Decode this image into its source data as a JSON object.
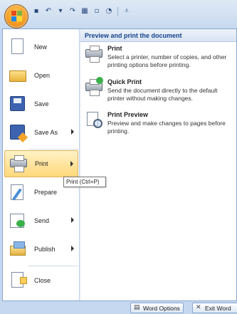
{
  "qat": {
    "icons": [
      "save-icon",
      "undo-icon",
      "redo-icon",
      "table-icon",
      "new-doc-icon",
      "print-preview-icon",
      "customize-icon"
    ]
  },
  "menu": {
    "items": [
      {
        "label": "New",
        "has_submenu": false
      },
      {
        "label": "Open",
        "has_submenu": false
      },
      {
        "label": "Save",
        "has_submenu": false
      },
      {
        "label": "Save As",
        "has_submenu": true
      },
      {
        "label": "Print",
        "has_submenu": true,
        "highlighted": true
      },
      {
        "label": "Prepare",
        "has_submenu": false
      },
      {
        "label": "Send",
        "has_submenu": true
      },
      {
        "label": "Publish",
        "has_submenu": true
      },
      {
        "label": "Close",
        "has_submenu": false
      }
    ],
    "panel_title": "Preview and print the document",
    "options": [
      {
        "title": "Print",
        "desc": "Select a printer, number of copies, and other printing options before printing."
      },
      {
        "title": "Quick Print",
        "desc": "Send the document directly to the default printer without making changes."
      },
      {
        "title": "Print Preview",
        "desc": "Preview and make changes to pages before printing."
      }
    ]
  },
  "tooltip": "Print (Ctrl+P)",
  "bottom": {
    "word_options": "Word Options",
    "exit": "Exit Word"
  }
}
